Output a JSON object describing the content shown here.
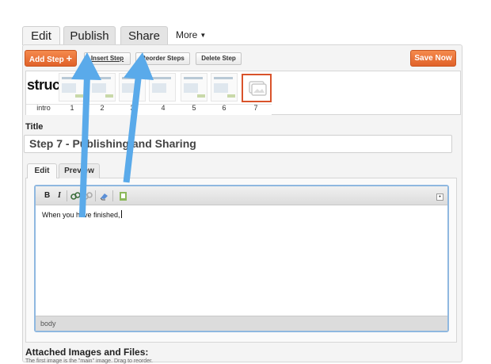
{
  "tabs": [
    {
      "label": "Edit",
      "active": true
    },
    {
      "label": "Publish",
      "active": false
    },
    {
      "label": "Share",
      "active": false
    }
  ],
  "more_menu": {
    "label": "More"
  },
  "step_toolbar": {
    "add_step": "Add Step",
    "add_icon": "+",
    "insert_step": "Insert Step",
    "reorder_steps": "Reorder Steps",
    "delete_step": "Delete Step",
    "save_now": "Save Now"
  },
  "steps": {
    "intro_thumb_text": "struc",
    "labels": [
      "intro",
      "1",
      "2",
      "3",
      "4",
      "5",
      "6",
      "7"
    ],
    "selected": "7"
  },
  "title": {
    "label": "Title",
    "value": "Step 7 - Publishing and Sharing"
  },
  "editor": {
    "tabs": [
      {
        "label": "Edit",
        "active": true
      },
      {
        "label": "Preview",
        "active": false
      }
    ],
    "toolbar": {
      "bold": "B",
      "italic": "I"
    },
    "content": "When you have finished,",
    "status": "body"
  },
  "attachments": {
    "heading": "Attached Images and Files:",
    "hint": "The first image is the \"main\" image. Drag to reorder."
  },
  "colors": {
    "accent_orange": "#e0622a",
    "selected_border": "#d9532b",
    "arrow_blue": "#5aaaea"
  }
}
